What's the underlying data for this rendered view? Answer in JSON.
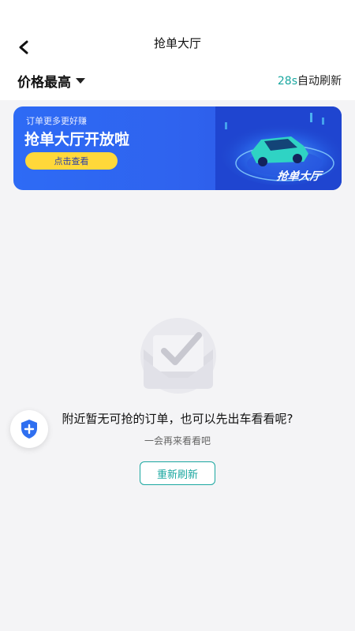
{
  "header": {
    "title": "抢单大厅",
    "back_icon": "chevron-left-icon"
  },
  "toolbar": {
    "sort_label": "价格最高",
    "sort_icon": "caret-down-icon",
    "refresh_seconds": "28s",
    "refresh_suffix": "自动刷新"
  },
  "banner": {
    "subtitle": "订单更多更好赚",
    "headline": "抢单大厅开放啦",
    "cta_label": "点击查看",
    "art_label": "抢单大厅",
    "art_icon": "car-illustration"
  },
  "empty_state": {
    "icon": "checkmark-tray-icon",
    "message": "附近暂无可抢的订单，也可以先出车看看呢?",
    "hint": "一会再来看看吧",
    "refresh_button": "重新刷新"
  },
  "floating": {
    "icon": "shield-plus-icon"
  },
  "colors": {
    "accent": "#1aa7a0",
    "banner_blue": "#2f62ee",
    "cta_yellow": "#ffd83a",
    "background": "#f4f4f6"
  }
}
